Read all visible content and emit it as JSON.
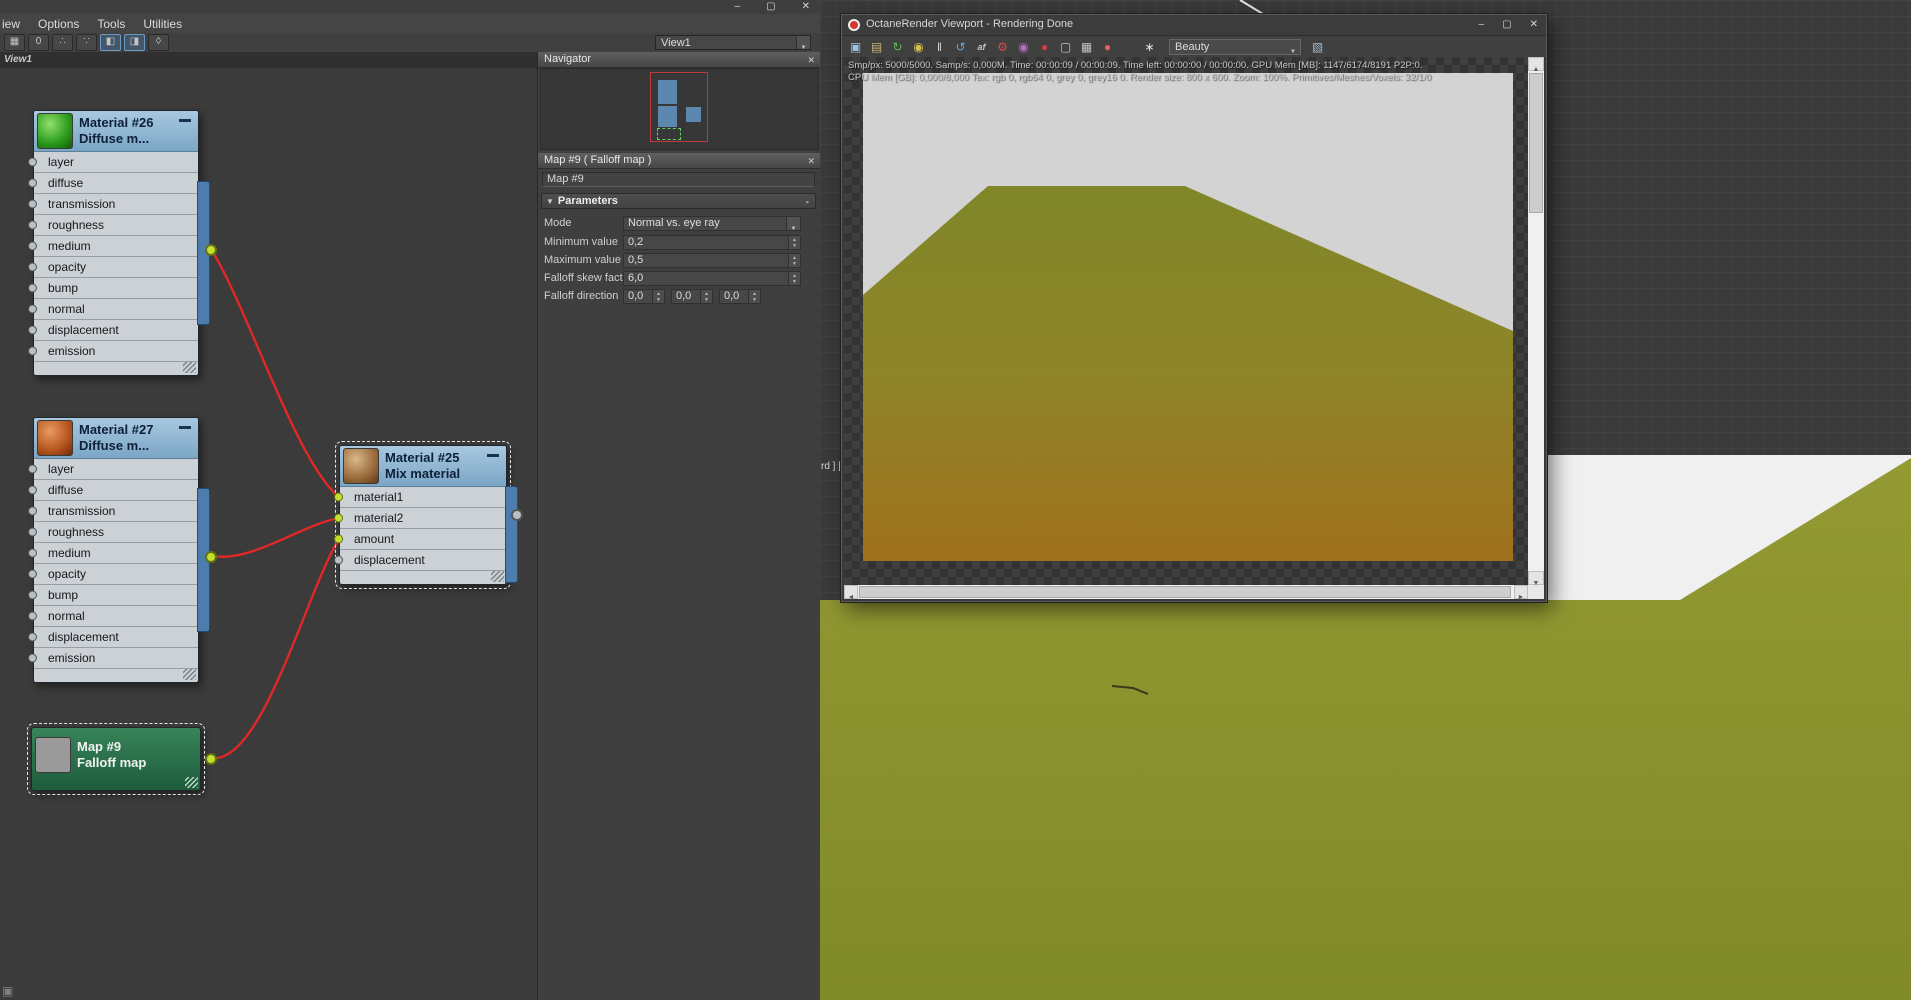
{
  "editor": {
    "titlebar": {
      "minimize": "–",
      "maximize": "▢",
      "close": "✕"
    },
    "menus": [
      "iew",
      "Options",
      "Tools",
      "Utilities"
    ],
    "toolbar_icons": [
      {
        "name": "grid-snap-icon",
        "glyph": "▦"
      },
      {
        "name": "zero-button",
        "glyph": "0"
      },
      {
        "name": "select-nodes-icon",
        "glyph": "∴"
      },
      {
        "name": "connect-nodes-icon",
        "glyph": "∵"
      },
      {
        "name": "layout-all-icon",
        "glyph": "◧"
      },
      {
        "name": "layout-children-icon",
        "glyph": "◨"
      },
      {
        "name": "pan-tool-icon",
        "glyph": "◊"
      }
    ],
    "view_tab": "View1",
    "view_dropdown": "View1"
  },
  "nodes": {
    "mat26": {
      "title": "Material #26",
      "subtitle": "Diffuse  m...",
      "slots": [
        "layer",
        "diffuse",
        "transmission",
        "roughness",
        "medium",
        "opacity",
        "bump",
        "normal",
        "displacement",
        "emission"
      ]
    },
    "mat27": {
      "title": "Material #27",
      "subtitle": "Diffuse  m...",
      "slots": [
        "layer",
        "diffuse",
        "transmission",
        "roughness",
        "medium",
        "opacity",
        "bump",
        "normal",
        "displacement",
        "emission"
      ]
    },
    "mat25": {
      "title": "Material #25",
      "subtitle": "Mix material",
      "slots": [
        "material1",
        "material2",
        "amount",
        "displacement"
      ]
    },
    "map9": {
      "title": "Map #9",
      "subtitle": "Falloff map"
    }
  },
  "navigator": {
    "title": "Navigator",
    "close": "✕"
  },
  "map_panel": {
    "title": "Map #9  ( Falloff map )",
    "close": "✕",
    "name_value": "Map #9",
    "rollout_title": "Parameters",
    "mode_label": "Mode",
    "mode_value": "Normal vs. eye ray",
    "min_label": "Minimum value",
    "min_value": "0,2",
    "max_label": "Maximum value",
    "max_value": "0,5",
    "skew_label": "Falloff skew factor",
    "skew_value": "6,0",
    "dir_label": "Falloff direction",
    "dir_values": [
      "0,0",
      "0,0",
      "0,0"
    ]
  },
  "octane": {
    "title": "OctaneRender Viewport - Rendering Done",
    "titlebar": {
      "minimize": "–",
      "maximize": "▢",
      "close": "✕"
    },
    "combo_value": "Beauty",
    "status_line1": "Smp/px: 5000/5000.  Samp/s: 0,000M.  Time: 00:00:09 / 00:00:09.  Time left: 00:00:00 / 00:00:00.  GPU Mem [MB]: 1147/6174/8191 P2P:0.",
    "status_line2": "CPU Mem [GB]: 0,000/8,000  Tex: rgb 0, rgb64 0, grey 0, grey16 0.  Render size: 800 x 600.  Zoom: 100%.  Primitives/Meshes/Voxels: 32/1/0",
    "toolbar_icons": [
      {
        "name": "export-image-icon",
        "glyph": "▣"
      },
      {
        "name": "save-image-icon",
        "glyph": "▤"
      },
      {
        "name": "restart-render-icon",
        "glyph": "↻"
      },
      {
        "name": "lock-resolution-icon",
        "glyph": "◉"
      },
      {
        "name": "pause-render-icon",
        "glyph": "‖"
      },
      {
        "name": "refresh-render-icon",
        "glyph": "↺"
      },
      {
        "name": "autofocus-icon",
        "glyph": "af"
      },
      {
        "name": "kernel-settings-icon",
        "glyph": "⚙"
      },
      {
        "name": "material-picker-icon",
        "glyph": "◉"
      },
      {
        "name": "stop-render-icon",
        "glyph": "●"
      },
      {
        "name": "display-settings-icon",
        "glyph": "▢"
      },
      {
        "name": "print-icon",
        "glyph": "▦"
      },
      {
        "name": "record-icon",
        "glyph": "●"
      },
      {
        "name": "render-target-icon",
        "glyph": "●"
      },
      {
        "name": "preferences-icon",
        "glyph": "∗"
      },
      {
        "name": "background-image-icon",
        "glyph": "▧"
      }
    ]
  },
  "viewport": {
    "label_fragment": "rd ] ["
  }
}
